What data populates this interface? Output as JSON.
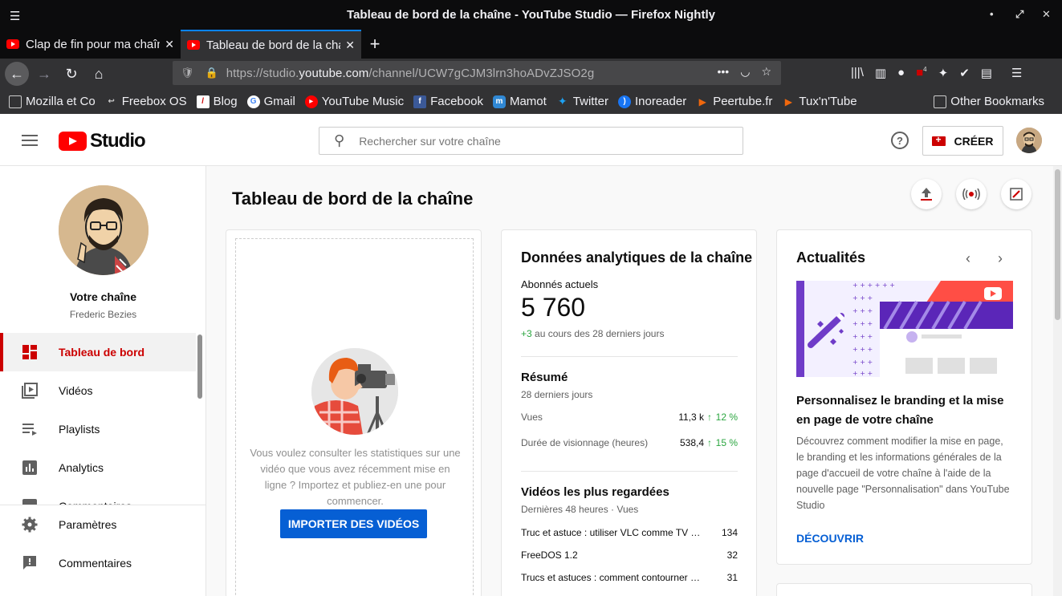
{
  "browser": {
    "window_title": "Tableau de bord de la chaîne - YouTube Studio — Firefox Nightly",
    "tabs": [
      {
        "label": "Clap de fin pour ma chaîne"
      },
      {
        "label": "Tableau de bord de la chaîne"
      }
    ],
    "url_prefix": "https://studio.",
    "url_domain": "youtube.com",
    "url_path": "/channel/UCW7gCJM3lrn3hoADvZJSO2g",
    "bookmarks": [
      {
        "label": "Mozilla et Co",
        "icon": "folder-icon"
      },
      {
        "label": "Freebox OS",
        "icon": "freebox-icon"
      },
      {
        "label": "Blog",
        "icon": "blog-icon"
      },
      {
        "label": "Gmail",
        "icon": "google-icon"
      },
      {
        "label": "YouTube Music",
        "icon": "youtube-music-icon"
      },
      {
        "label": "Facebook",
        "icon": "facebook-icon"
      },
      {
        "label": "Mamot",
        "icon": "mastodon-icon"
      },
      {
        "label": "Twitter",
        "icon": "twitter-icon"
      },
      {
        "label": "Inoreader",
        "icon": "inoreader-icon"
      },
      {
        "label": "Peertube.fr",
        "icon": "peertube-icon"
      },
      {
        "label": "Tux'n'Tube",
        "icon": "peertube-icon"
      }
    ],
    "other_bookmarks": "Other Bookmarks",
    "ublock_badge": "4"
  },
  "header": {
    "logo_text": "Studio",
    "search_placeholder": "Rechercher sur votre chaîne",
    "create_label": "CRÉER"
  },
  "sidebar": {
    "channel_title": "Votre chaîne",
    "channel_name": "Frederic Bezies",
    "items": [
      {
        "label": "Tableau de bord",
        "icon": "dashboard-icon",
        "active": true
      },
      {
        "label": "Vidéos",
        "icon": "videos-icon"
      },
      {
        "label": "Playlists",
        "icon": "playlists-icon"
      },
      {
        "label": "Analytics",
        "icon": "analytics-icon"
      },
      {
        "label": "Commentaires",
        "icon": "comments-icon"
      }
    ],
    "bottom_items": [
      {
        "label": "Paramètres",
        "icon": "settings-icon"
      },
      {
        "label": "Commentaires",
        "icon": "feedback-icon"
      }
    ]
  },
  "main": {
    "page_title": "Tableau de bord de la chaîne",
    "upload_card": {
      "message": "Vous voulez consulter les statistiques sur une vidéo que vous avez récemment mise en ligne ? Importez et publiez-en une pour commencer.",
      "button": "IMPORTER DES VIDÉOS"
    },
    "analytics": {
      "title": "Données analytiques de la chaîne",
      "subscribers_label": "Abonnés actuels",
      "subscribers_value": "5 760",
      "subscribers_delta": "+3",
      "subscribers_delta_text": "au cours des 28 derniers jours",
      "summary_title": "Résumé",
      "summary_sub": "28 derniers jours",
      "metrics": [
        {
          "label": "Vues",
          "value": "11,3 k",
          "change": "12 %"
        },
        {
          "label": "Durée de visionnage (heures)",
          "value": "538,4",
          "change": "15 %"
        }
      ],
      "top_title": "Vidéos les plus regardées",
      "top_sub": "Dernières 48 heures · Vues",
      "top_videos": [
        {
          "title": "Truc et astuce : utiliser VLC comme TV …",
          "views": "134"
        },
        {
          "title": "FreeDOS 1.2",
          "views": "32"
        },
        {
          "title": "Trucs et astuces : comment contourner …",
          "views": "31"
        }
      ]
    },
    "news": {
      "title": "Actualités",
      "headline": "Personnalisez le branding et la mise en page de votre chaîne",
      "body": "Découvrez comment modifier la mise en page, le branding et les informations générales de la page d'accueil de votre chaîne à l'aide de la nouvelle page \"Personnalisation\" dans YouTube Studio",
      "link": "DÉCOUVRIR"
    }
  },
  "colors": {
    "accent_red": "#cc0000",
    "youtube_red": "#ff0000",
    "link_blue": "#065fd4",
    "positive_green": "#2ba640"
  }
}
